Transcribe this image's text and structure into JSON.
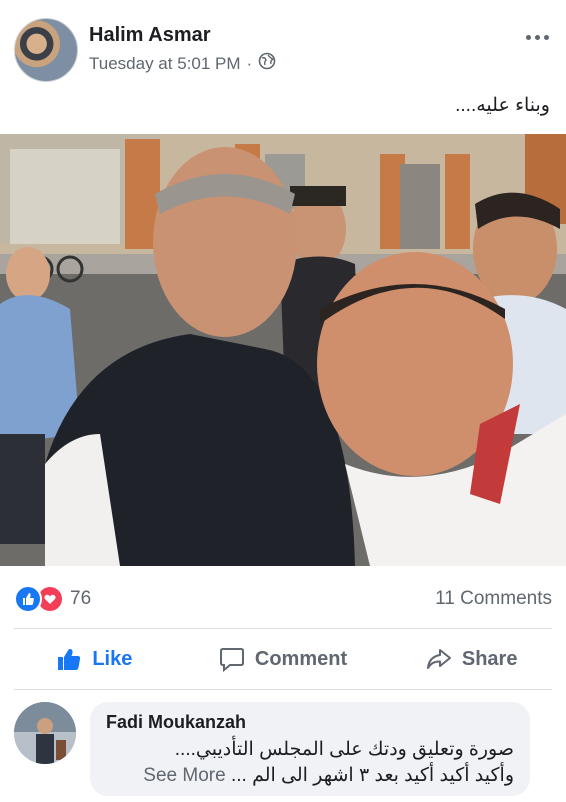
{
  "post": {
    "author": "Halim Asmar",
    "time": "Tuesday at 5:01 PM",
    "separator": "·",
    "privacy_icon": "globe-icon",
    "more_icon": "more-dots-icon",
    "text": "وبناء عليه...."
  },
  "photo": {
    "description_icon": "group-selfie-photo"
  },
  "reactions": {
    "icons": [
      "like-icon",
      "love-icon"
    ],
    "count": "76",
    "comments_count": "11 Comments"
  },
  "actions": {
    "like_label": "Like",
    "comment_label": "Comment",
    "share_label": "Share"
  },
  "comment": {
    "author": "Fadi Moukanzah",
    "line1": "صورة وتعليق ودتك على المجلس التأديبي....",
    "line2_text": "وأكيد أكيد أكيد بعد ٣ اشهر الى الم ...",
    "see_more": "See More"
  },
  "colors": {
    "brand_blue": "#1877f2",
    "love_red": "#f33e58",
    "meta_gray": "#606770"
  }
}
